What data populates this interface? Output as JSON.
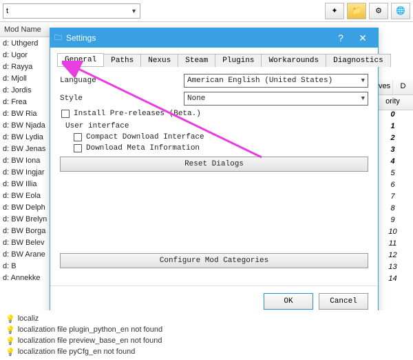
{
  "toolbar": {
    "combo_value": "t"
  },
  "columns": {
    "mod_name": "Mod Name",
    "aves": "aves",
    "d": "D",
    "priority": "ority"
  },
  "mod_list": [
    "d: Uthgerd",
    "d: Ugor",
    "d: Rayya",
    "d: Mjoll",
    "d: Jordis",
    "d: Frea",
    "d: BW Ria",
    "d: BW Njada",
    "d: BW Lydia",
    "d: BW Jenas",
    "d: BW Iona",
    "d: BW Ingjar",
    "d: BW Illia",
    "d: BW Eola",
    "d: BW Delph",
    "d: BW Brelyn",
    "d: BW Borga",
    "d: BW Belev",
    "d: BW Arane",
    "d: B",
    "d: Annekke"
  ],
  "priority_list": [
    "0",
    "1",
    "2",
    "3",
    "4",
    "5",
    "6",
    "7",
    "8",
    "9",
    "10",
    "11",
    "12",
    "13",
    "14"
  ],
  "dialog": {
    "title": "Settings",
    "tabs": [
      "General",
      "Paths",
      "Nexus",
      "Steam",
      "Plugins",
      "Workarounds",
      "Diagnostics"
    ],
    "active_tab": 0,
    "language_label": "Language",
    "language_value": "American English (United States)",
    "style_label": "Style",
    "style_value": "None",
    "install_prerelease": "Install Pre-releases (Beta.)",
    "user_interface_label": "User interface",
    "compact_download": "Compact Download Interface",
    "download_meta": "Download Meta Information",
    "reset_dialogs": "Reset Dialogs",
    "configure_categories": "Configure Mod Categories",
    "ok": "OK",
    "cancel": "Cancel"
  },
  "log": [
    "localiz",
    "localization file plugin_python_en not found",
    "localization file preview_base_en not found",
    "localization file pyCfg_en not found"
  ]
}
